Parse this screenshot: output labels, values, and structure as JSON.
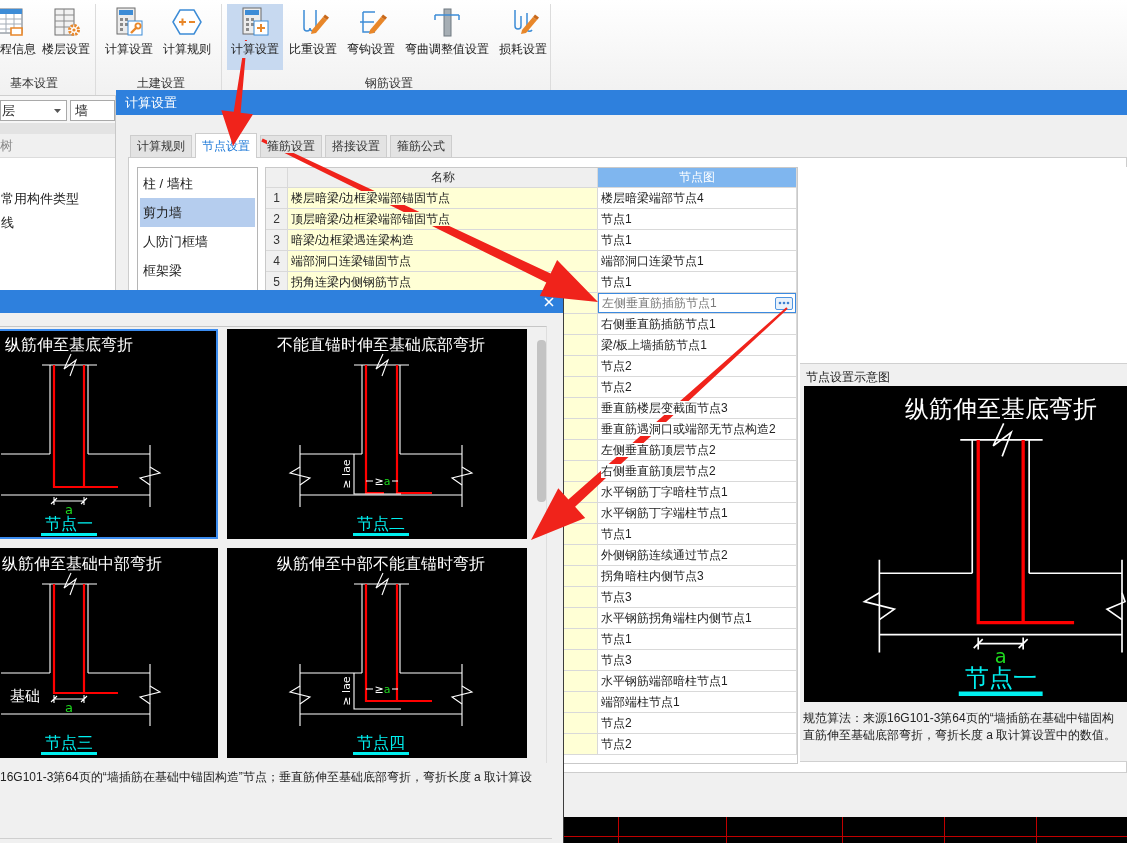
{
  "ribbon": {
    "groups": [
      {
        "label": "基本设置",
        "buttons": [
          {
            "label": "程信息",
            "selected": false
          },
          {
            "label": "楼层设置",
            "selected": false
          }
        ]
      },
      {
        "label": "土建设置",
        "buttons": [
          {
            "label": "计算设置",
            "selected": false
          },
          {
            "label": "计算规则",
            "selected": false
          }
        ]
      },
      {
        "label": "钢筋设置",
        "buttons": [
          {
            "label": "计算设置",
            "selected": true
          },
          {
            "label": "比重设置",
            "selected": false
          },
          {
            "label": "弯钩设置",
            "selected": false
          },
          {
            "label": "弯曲调整值设置",
            "selected": false
          },
          {
            "label": "损耗设置",
            "selected": false
          }
        ]
      }
    ]
  },
  "side_panel": {
    "floor_dropdown": {
      "value": "层"
    },
    "type_field": {
      "value": "墙"
    },
    "tree": {
      "title": "树",
      "items": [
        "常用构件类型",
        "线"
      ]
    }
  },
  "dialog": {
    "title": "计算设置",
    "tabs": [
      {
        "label": "计算规则",
        "selected": false
      },
      {
        "label": "节点设置",
        "selected": true
      },
      {
        "label": "箍筋设置",
        "selected": false
      },
      {
        "label": "搭接设置",
        "selected": false
      },
      {
        "label": "箍筋公式",
        "selected": false
      }
    ],
    "categories": [
      {
        "label": "柱 / 墙柱",
        "selected": false
      },
      {
        "label": "剪力墙",
        "selected": true
      },
      {
        "label": "人防门框墙",
        "selected": false
      },
      {
        "label": "框架梁",
        "selected": false
      }
    ],
    "table": {
      "columns": [
        "名称",
        "节点图"
      ],
      "rows": [
        {
          "number": "1",
          "name": "楼层暗梁/边框梁端部锚固节点",
          "node": "楼层暗梁端部节点4",
          "selected": false
        },
        {
          "number": "2",
          "name": "顶层暗梁/边框梁端部锚固节点",
          "node": "节点1",
          "selected": false
        },
        {
          "number": "3",
          "name": "暗梁/边框梁遇连梁构造",
          "node": "节点1",
          "selected": false
        },
        {
          "number": "4",
          "name": "端部洞口连梁锚固节点",
          "node": "端部洞口连梁节点1",
          "selected": false
        },
        {
          "number": "5",
          "name": "拐角连梁内侧钢筋节点",
          "node": "节点1",
          "selected": false
        },
        {
          "node": "左侧垂直筋插筋节点1",
          "selected": true
        },
        {
          "node": "右侧垂直筋插筋节点1",
          "selected": false
        },
        {
          "node": "梁/板上墙插筋节点1",
          "selected": false
        },
        {
          "node": "节点2",
          "selected": false
        },
        {
          "node": "节点2",
          "selected": false
        },
        {
          "node": "垂直筋楼层变截面节点3",
          "selected": false
        },
        {
          "node": "垂直筋遇洞口或端部无节点构造2",
          "selected": false
        },
        {
          "node": "左侧垂直筋顶层节点2",
          "selected": false
        },
        {
          "node": "右侧垂直筋顶层节点2",
          "selected": false
        },
        {
          "node": "水平钢筋丁字暗柱节点1",
          "selected": false
        },
        {
          "node": "水平钢筋丁字端柱节点1",
          "selected": false
        },
        {
          "node": "节点1",
          "selected": false
        },
        {
          "node": "外侧钢筋连续通过节点2",
          "selected": false
        },
        {
          "node": "拐角暗柱内侧节点3",
          "selected": false
        },
        {
          "node": "节点3",
          "selected": false
        },
        {
          "node": "水平钢筋拐角端柱内侧节点1",
          "selected": false
        },
        {
          "node": "节点1",
          "selected": false
        },
        {
          "node": "节点3",
          "selected": false
        },
        {
          "node": "水平钢筋端部暗柱节点1",
          "selected": false
        },
        {
          "node": "端部端柱节点1",
          "selected": false
        },
        {
          "node": "节点2",
          "selected": false
        },
        {
          "node": "节点2",
          "selected": false
        }
      ]
    },
    "preview": {
      "title": "节点设置示意图",
      "drawing": {
        "kind": "bend_bottom",
        "title": "纵筋伸至基底弯折",
        "dimension": "a",
        "caption": "节点一"
      },
      "description": [
        "规范算法：来源16G101-3第64页的“墙插筋在基础中锚固构",
        "直筋伸至基础底部弯折，弯折长度 a 取计算设置中的数值。"
      ]
    }
  },
  "node_picker": {
    "cards": [
      {
        "kind": "bend_bottom",
        "title": "纵筋伸至基底弯折",
        "dimension": "a",
        "caption": "节点一",
        "selected": true
      },
      {
        "kind": "lae_bottom",
        "title": "不能直锚时伸至基础底部弯折",
        "dimension_sign": "≥",
        "dimension": "a",
        "anchorage": "≥ lae",
        "caption": "节点二",
        "selected": false
      },
      {
        "kind": "bend_middle",
        "title": "纵筋伸至基础中部弯折",
        "base_label": "基础",
        "dimension": "a",
        "caption": "节点三",
        "selected": false
      },
      {
        "kind": "lae_middle",
        "title": "纵筋伸至中部不能直锚时弯折",
        "dimension_sign": "≥",
        "dimension": "a",
        "anchorage": "≥ lae",
        "caption": "节点四",
        "selected": false
      }
    ],
    "description": "16G101-3第64页的“墙插筋在基础中锚固构造”节点；垂直筋伸至基础底部弯折，弯折长度 a 取计算设"
  }
}
